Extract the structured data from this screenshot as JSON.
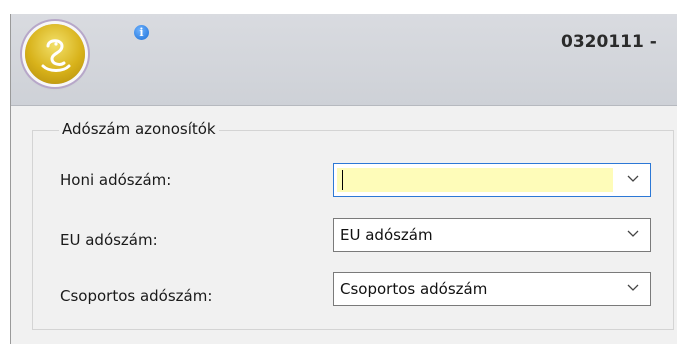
{
  "header": {
    "document_title": "0320111 -",
    "info_icon": "info-icon",
    "app_orb_icon": "snake-logo-icon"
  },
  "group": {
    "title": "Adószám azonosítók",
    "fields": [
      {
        "label": "Honi adószám:",
        "value": "",
        "placeholder": "",
        "focused": true
      },
      {
        "label": "EU adószám:",
        "value": "EU adószám",
        "placeholder": "",
        "focused": false
      },
      {
        "label": "Csoportos adószám:",
        "value": "Csoportos adószám",
        "placeholder": "",
        "focused": false
      }
    ]
  },
  "colors": {
    "focus_border": "#2c78d6",
    "input_highlight": "#fefcb9",
    "orb_gold": "#d8b21a"
  }
}
